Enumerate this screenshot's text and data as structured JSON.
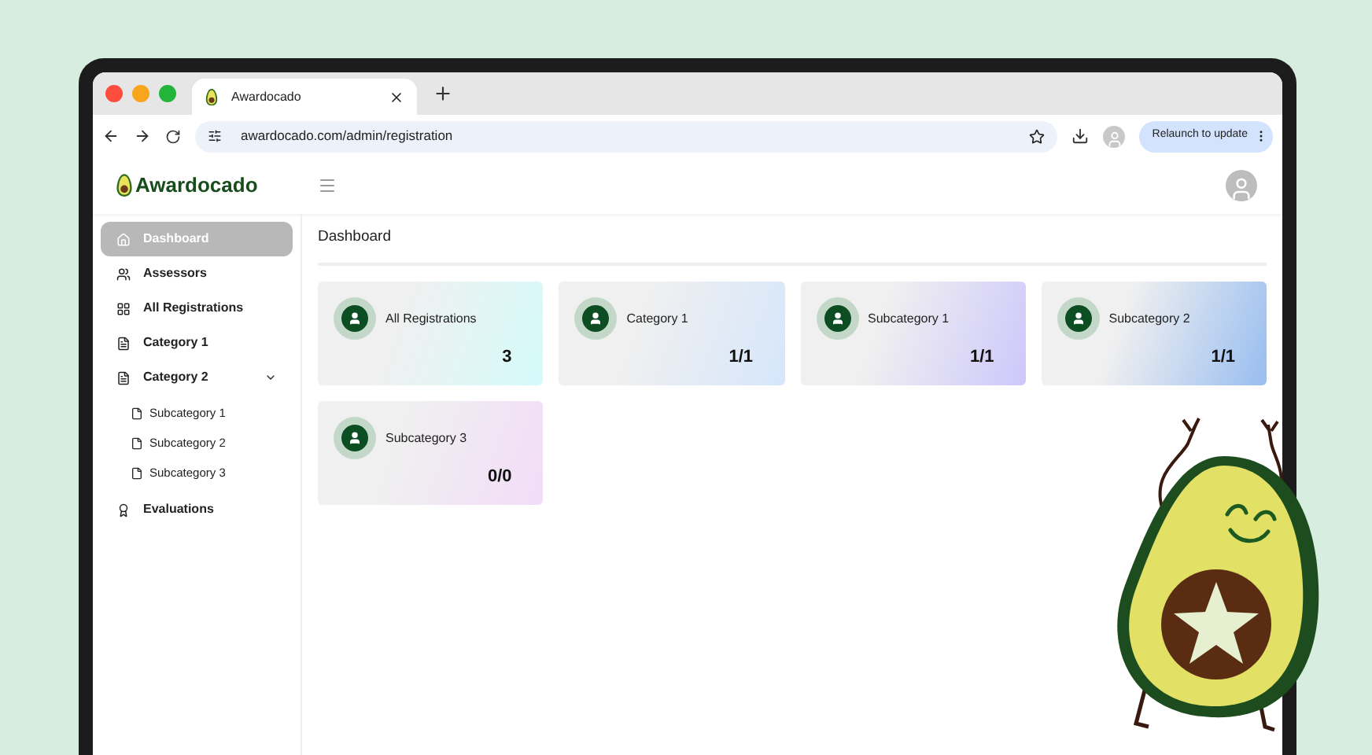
{
  "browser": {
    "tab_title": "Awardocado",
    "url": "awardocado.com/admin/registration",
    "relaunch_button": "Relaunch to update"
  },
  "app": {
    "logo": "Awardocado"
  },
  "sidebar": {
    "items": [
      {
        "label": "Dashboard",
        "kind": "home",
        "selected": true
      },
      {
        "label": "Assessors",
        "kind": "users",
        "selected": false
      },
      {
        "label": "All Registrations",
        "kind": "grid",
        "selected": false
      },
      {
        "label": "Category 1",
        "kind": "file",
        "selected": false
      },
      {
        "label": "Category 2",
        "kind": "file",
        "selected": false,
        "expanded": true,
        "children": [
          {
            "label": "Subcategory 1",
            "selected": false
          },
          {
            "label": "Subcategory 2",
            "selected": false
          },
          {
            "label": "Subcategory 3",
            "selected": false
          }
        ]
      },
      {
        "label": "Evaluations",
        "kind": "award",
        "selected": false
      }
    ]
  },
  "page": {
    "title": "Dashboard"
  },
  "cards": [
    {
      "label": "All Registrations",
      "value": "3",
      "color": "#d4fbfa"
    },
    {
      "label": "Category 1",
      "value": "1/1",
      "color": "#d5e6fb"
    },
    {
      "label": "Subcategory 1",
      "value": "1/1",
      "color": "#cdc7fb"
    },
    {
      "label": "Subcategory 2",
      "value": "1/1",
      "color": "#98bdf0"
    },
    {
      "label": "Subcategory 3",
      "value": "0/0",
      "color": "#f2dcf8"
    }
  ]
}
